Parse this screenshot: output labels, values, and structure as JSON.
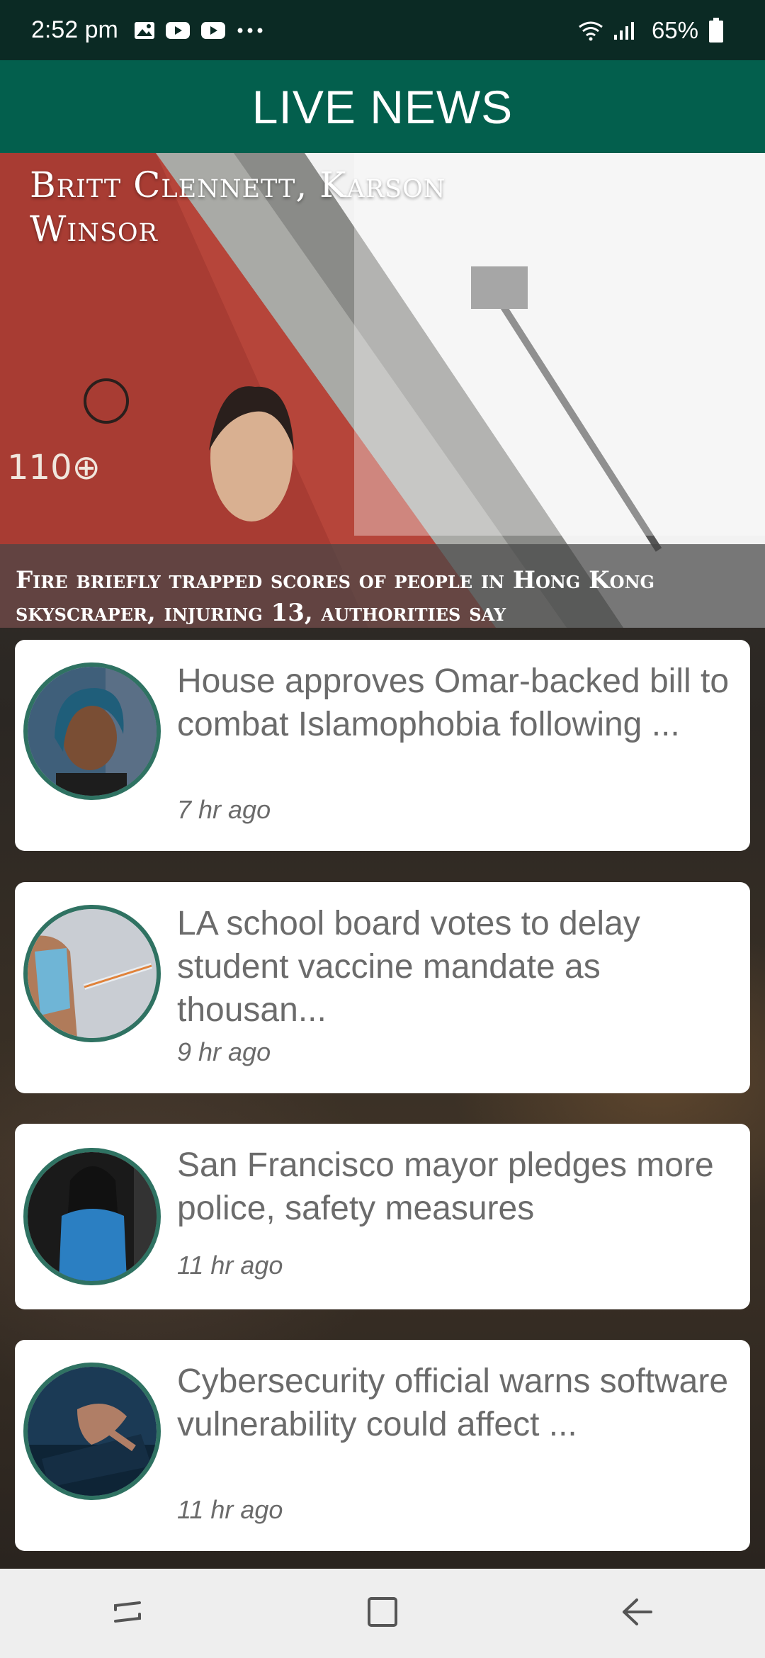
{
  "status_bar": {
    "time": "2:52 pm",
    "icons": [
      "gallery-icon",
      "youtube-icon",
      "youtube-icon",
      "more-dots-icon"
    ],
    "battery": "65%"
  },
  "app": {
    "title": "LIVE NEWS"
  },
  "hero": {
    "names": "Britt Clennett, Karson Winsor",
    "caption": "Fire briefly trapped scores of people in Hong Kong skyscraper, injuring 13, authorities say"
  },
  "articles": [
    {
      "title": "House approves Omar-backed bill to combat Islamophobia following ...",
      "time": "7 hr ago"
    },
    {
      "title": "LA school board votes to delay student vaccine mandate as thousan...",
      "time": "9 hr ago"
    },
    {
      "title": "San Francisco mayor pledges more police, safety measures",
      "time": "11 hr ago"
    },
    {
      "title": "Cybersecurity official warns software vulnerability could affect ...",
      "time": "11 hr ago"
    }
  ],
  "nav": {
    "buttons": [
      "recent-apps-icon",
      "home-icon",
      "back-icon"
    ]
  },
  "colors": {
    "app_bar": "#035f4d",
    "status_bar": "#0b2a24",
    "thumb_border": "#2f7262",
    "card_text": "#6b6b6b"
  }
}
